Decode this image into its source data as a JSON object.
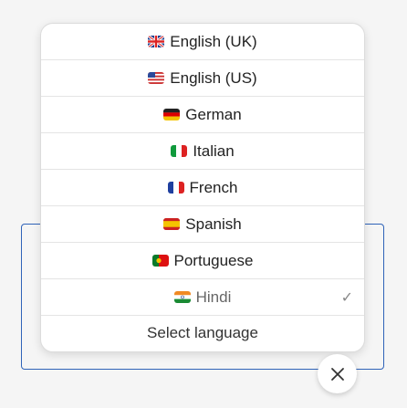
{
  "languages": [
    {
      "label": "English (UK)",
      "flag": "flag-uk-icon"
    },
    {
      "label": "English (US)",
      "flag": "flag-us-icon"
    },
    {
      "label": "German",
      "flag": "flag-de-icon"
    },
    {
      "label": "Italian",
      "flag": "flag-it-icon"
    },
    {
      "label": "French",
      "flag": "flag-fr-icon"
    },
    {
      "label": "Spanish",
      "flag": "flag-es-icon"
    },
    {
      "label": "Portuguese",
      "flag": "flag-pt-icon"
    },
    {
      "label": "Hindi",
      "flag": "flag-in-icon",
      "selected": true
    }
  ],
  "selected_check": "✓",
  "footer_label": "Select language",
  "close_icon": "close-icon"
}
